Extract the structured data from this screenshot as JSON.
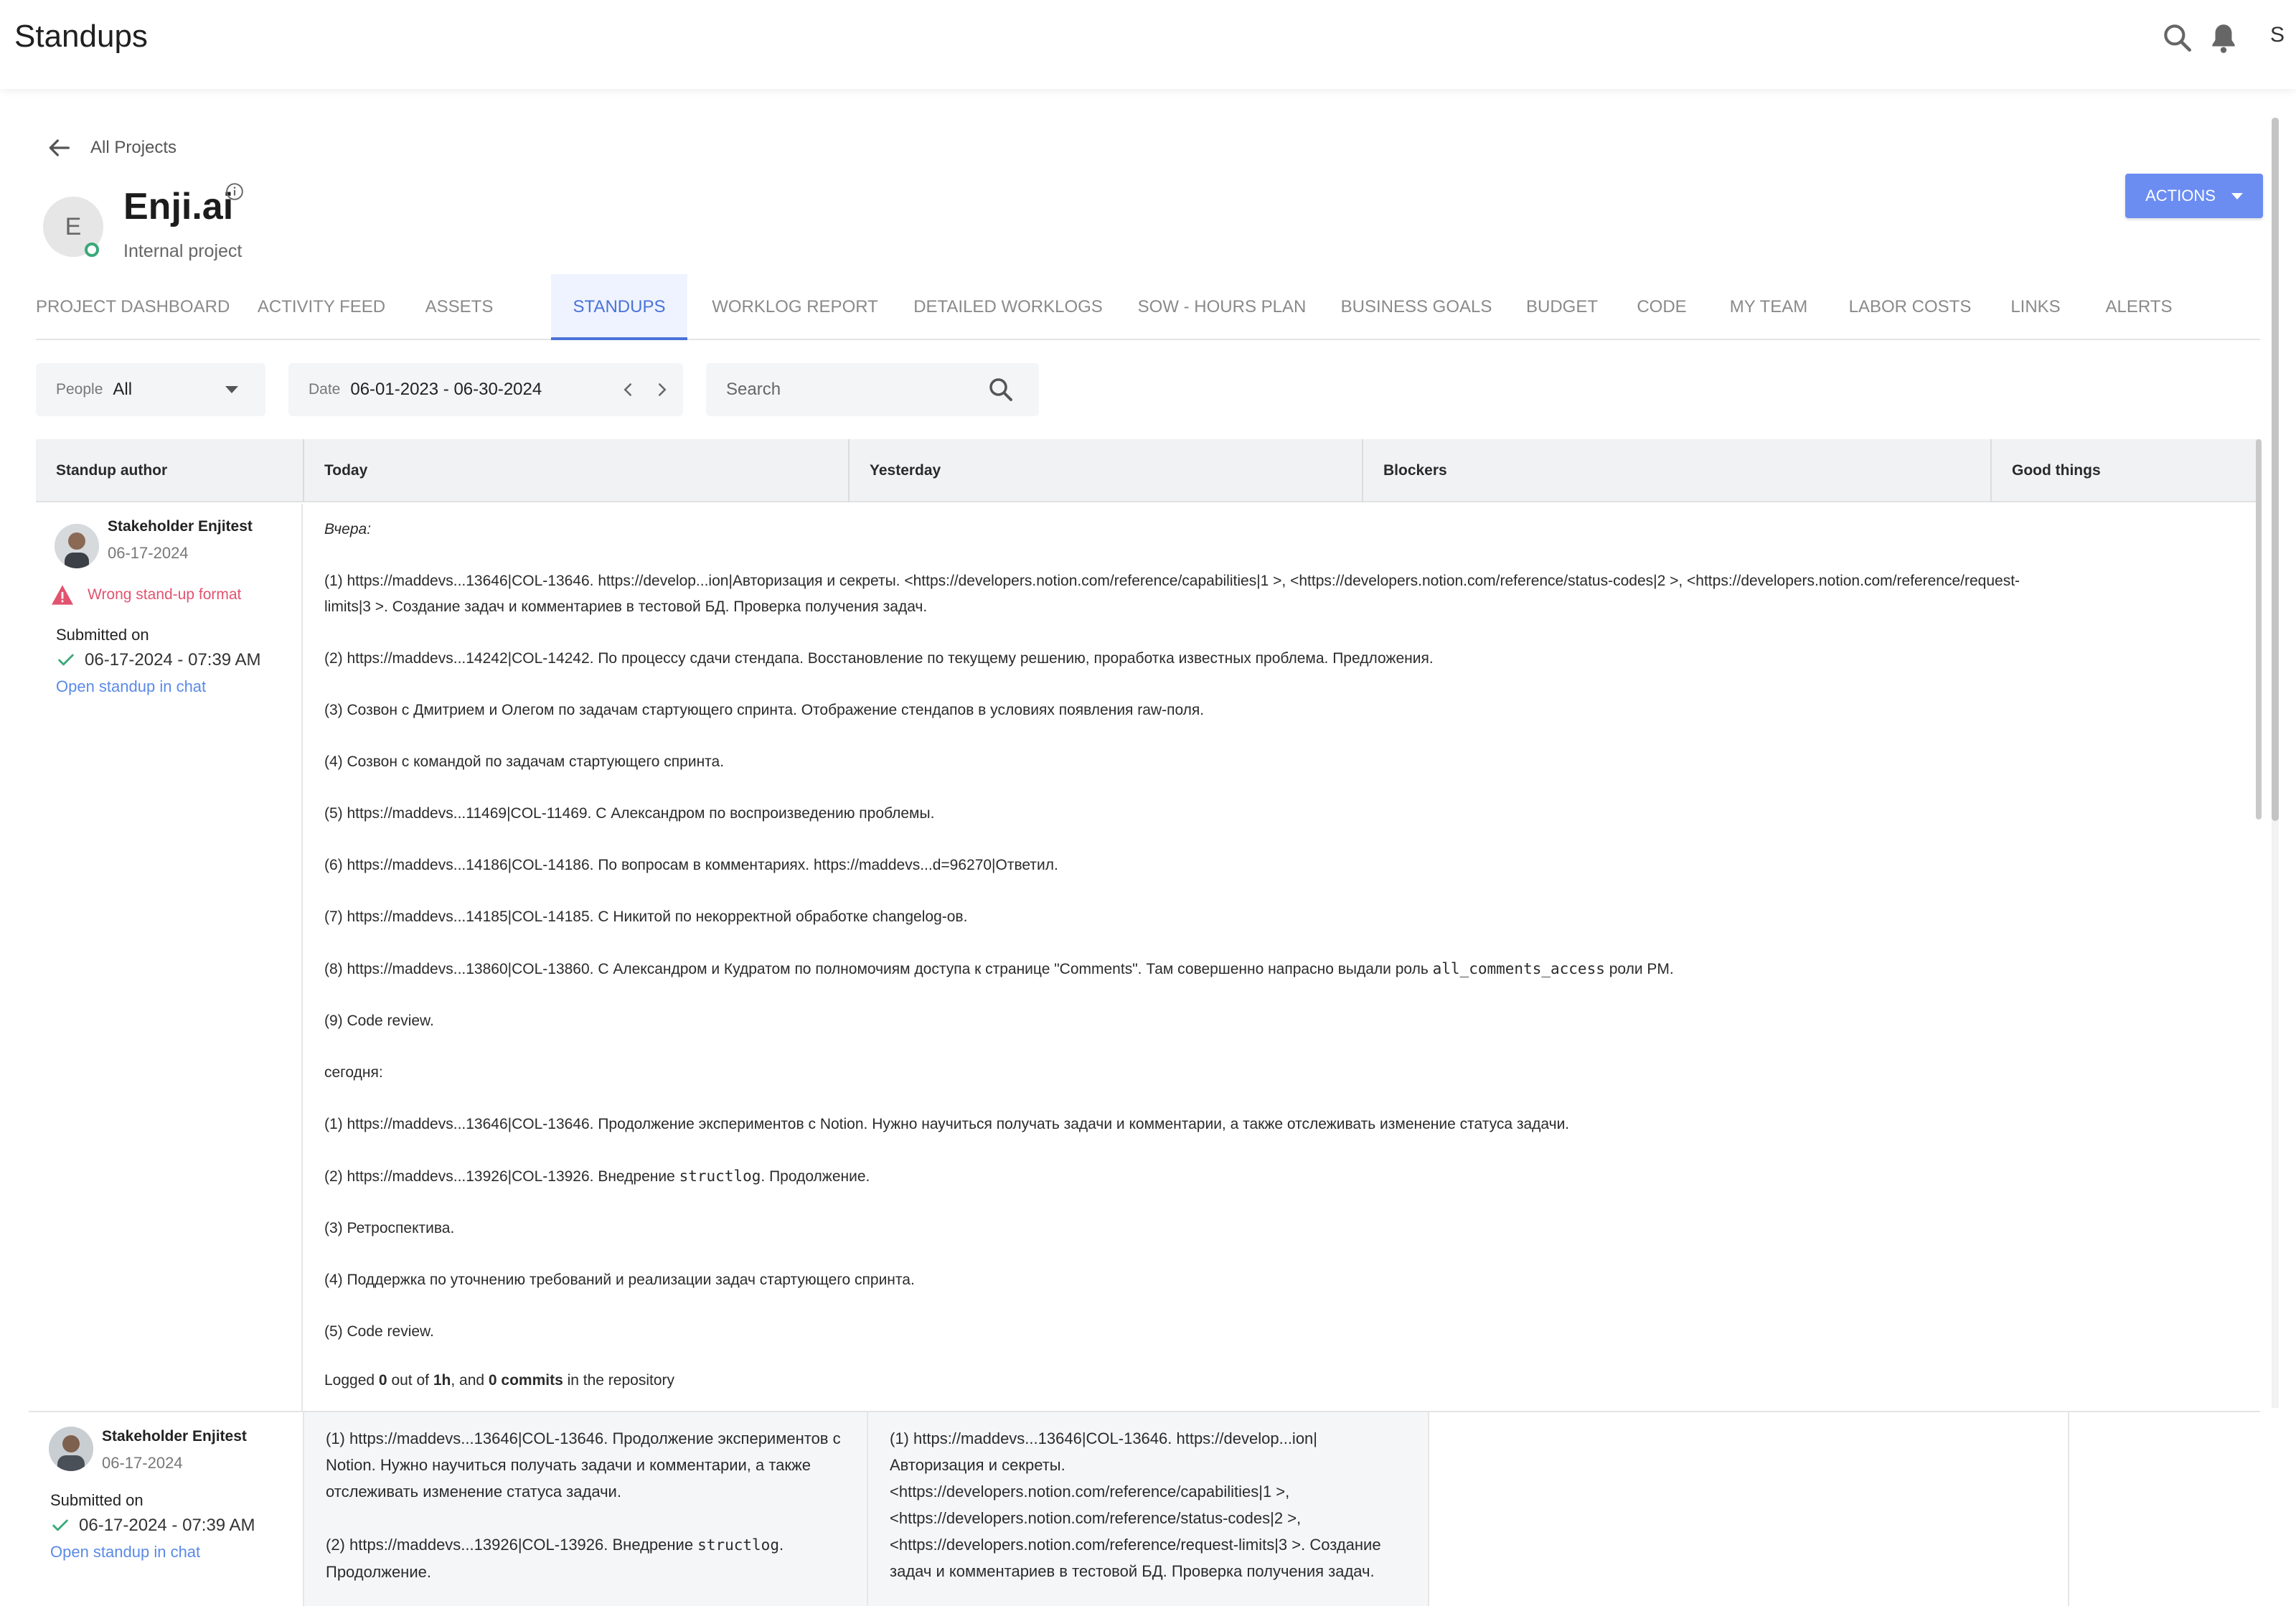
{
  "app": {
    "title": "Standups",
    "user_initial": "S"
  },
  "header": {
    "back_label": "All Projects",
    "avatar_letter": "E",
    "project_name": "Enji.ai",
    "project_type": "Internal project",
    "actions_label": "ACTIONS"
  },
  "tabs": [
    {
      "label": "PROJECT DASHBOARD"
    },
    {
      "label": "ACTIVITY FEED"
    },
    {
      "label": "ASSETS"
    },
    {
      "label": "STANDUPS",
      "active": true
    },
    {
      "label": "WORKLOG REPORT"
    },
    {
      "label": "DETAILED WORKLOGS"
    },
    {
      "label": "SOW - HOURS PLAN"
    },
    {
      "label": "BUSINESS GOALS"
    },
    {
      "label": "BUDGET"
    },
    {
      "label": "CODE"
    },
    {
      "label": "MY TEAM"
    },
    {
      "label": "LABOR COSTS"
    },
    {
      "label": "LINKS"
    },
    {
      "label": "ALERTS"
    }
  ],
  "filters": {
    "people_label": "People",
    "people_value": "All",
    "date_label": "Date",
    "date_value": "06-01-2023 - 06-30-2024",
    "search_placeholder": "Search"
  },
  "table": {
    "columns": [
      "Standup author",
      "Today",
      "Yesterday",
      "Blockers",
      "Good things"
    ],
    "rows": [
      {
        "author": "Stakeholder Enjitest",
        "date": "06-17-2024",
        "warning": "Wrong stand-up format",
        "submitted_label": "Submitted on",
        "submitted_at": "06-17-2024 - 07:39 AM",
        "open_link": "Open standup in chat",
        "raw_heading_yesterday": "Вчера:",
        "yesterday_items": [
          "(1) https://maddevs...13646|COL-13646. https://develop...ion|Авторизация и секреты. <https://developers.notion.com/reference/capabilities|1 >, <https://developers.notion.com/reference/status-codes|2 >, <https://developers.notion.com/reference/request-",
          "limits|3 >. Создание задач и комментариев в тестовой БД. Проверка получения задач.",
          "(2) https://maddevs...14242|COL-14242. По процессу сдачи стендапа. Восстановление по текущему решению, проработка известных проблема. Предложения.",
          "(3) Созвон с Дмитрием и Олегом по задачам стартующего спринта. Отображение стендапов в условиях появления raw-поля.",
          "(4) Созвон с командой по задачам стартующего спринта.",
          "(5) https://maddevs...11469|COL-11469. С Александром по воспроизведению проблемы.",
          "(6) https://maddevs...14186|COL-14186. По вопросам в комментариях. https://maddevs...d=96270|Ответил.",
          "(7) https://maddevs...14185|COL-14185. С Никитой по некорректной обработке changelog-ов.",
          "(8) https://maddevs...13860|COL-13860. С Александром и Кудратом по полномочиям доступа к странице \"Comments\". Там совершенно напрасно выдали роль ",
          "all_comments_access",
          " роли PM.",
          "(9) Code review."
        ],
        "raw_heading_today": "сегодня:",
        "today_items": [
          "(1) https://maddevs...13646|COL-13646. Продолжение экспериментов с Notion. Нужно научиться получать задачи и комментарии, а также отслеживать изменение статуса задачи.",
          "(2) https://maddevs...13926|COL-13926. Внедрение ",
          "structlog",
          ". Продолжение.",
          "(3) Ретроспектива.",
          "(4) Поддержка по уточнению требований и реализации задач стартующего спринта.",
          "(5) Code review."
        ],
        "logged": {
          "prefix": "Logged ",
          "hours_logged": "0",
          "mid": " out of ",
          "hours_total": "1h",
          "mid2": ", and ",
          "commits": "0 commits",
          "suffix": " in the repository"
        }
      },
      {
        "author": "Stakeholder Enjitest",
        "date": "06-17-2024",
        "submitted_label": "Submitted on",
        "submitted_at": "06-17-2024 - 07:39 AM",
        "open_link": "Open standup in chat",
        "today_1": "(1) https://maddevs...13646|COL-13646. Продолжение экспериментов с Notion. Нужно научиться получать задачи и комментарии, а также отслеживать изменение статуса задачи.",
        "today_2_prefix": "(2) https://maddevs...13926|COL-13926. Внедрение ",
        "today_2_code": "structlog",
        "today_2_suffix": ". Продолжение.",
        "yesterday_text": "(1) https://maddevs...13646|COL-13646. https://develop...ion| Авторизация и секреты. <https://developers.notion.com/reference/capabilities|1 >, <https://developers.notion.com/reference/status-codes|2 >, <https://developers.notion.com/reference/request-limits|3 >. Создание задач и комментариев в тестовой БД. Проверка получения задач."
      }
    ]
  },
  "colors": {
    "accent": "#4a72d8",
    "actions_button": "#6b8df2",
    "warning": "#e2536f",
    "link": "#5b8ae6",
    "success": "#3aa87a"
  }
}
